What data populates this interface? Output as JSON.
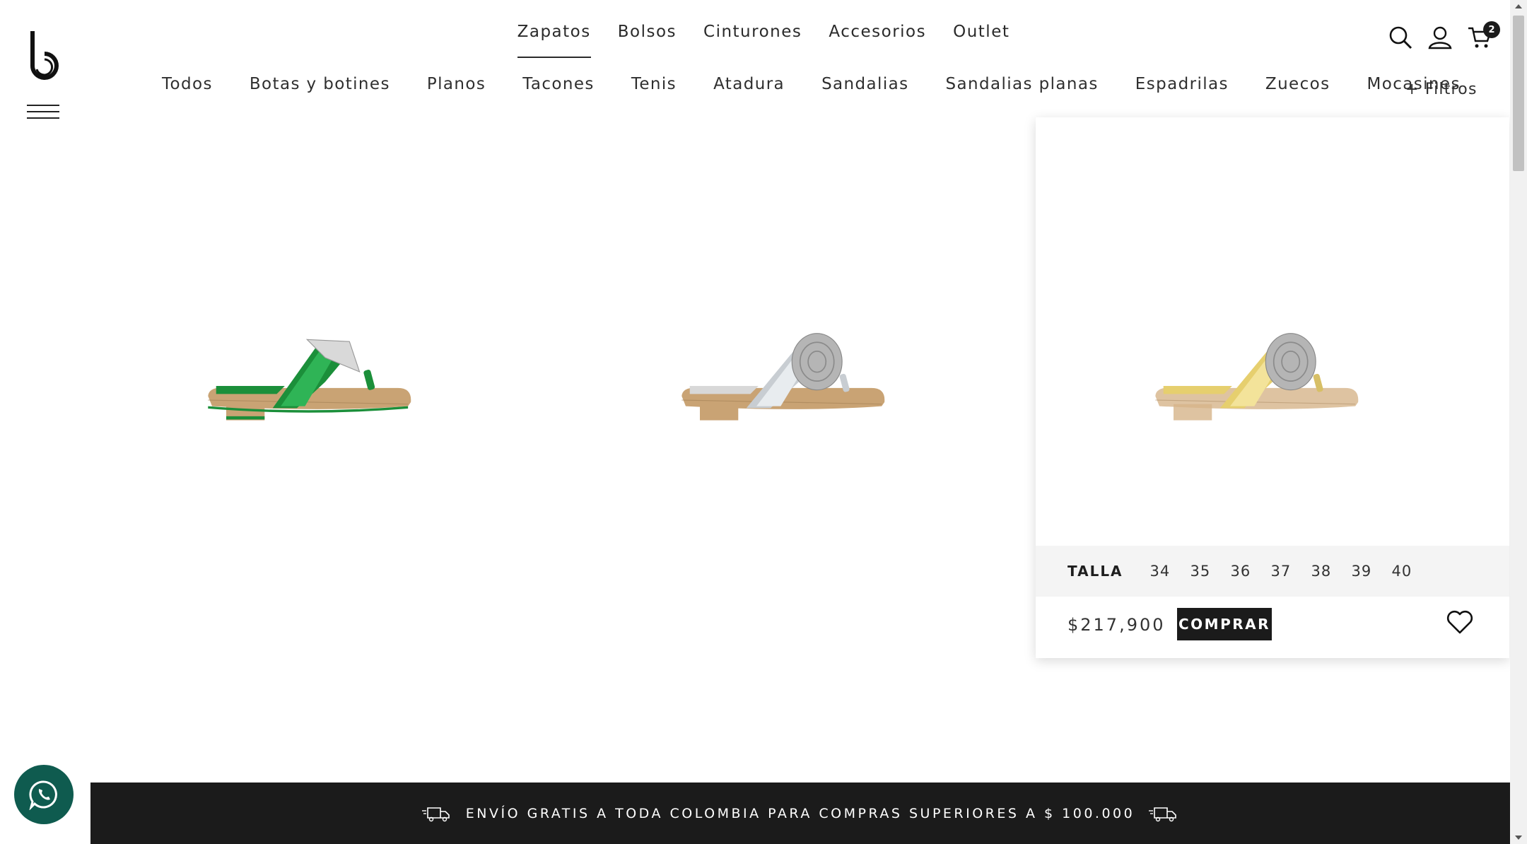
{
  "brand": {
    "logo_icon": "b-logo-icon"
  },
  "main_nav": [
    {
      "label": "Zapatos",
      "active": true
    },
    {
      "label": "Bolsos"
    },
    {
      "label": "Cinturones"
    },
    {
      "label": "Accesorios"
    },
    {
      "label": "Outlet"
    }
  ],
  "header_icons": {
    "search": "search-icon",
    "account": "user-icon",
    "cart": "cart-icon",
    "cart_count": "2"
  },
  "sub_nav": [
    "Todos",
    "Botas y botines",
    "Planos",
    "Tacones",
    "Tenis",
    "Atadura",
    "Sandalias",
    "Sandalias planas",
    "Espadrilas",
    "Zuecos",
    "Mocasines"
  ],
  "filters_label": "+ Filtros",
  "products": [
    {
      "color": "green",
      "accent": "#1b8f3a"
    },
    {
      "color": "silver",
      "accent": "#c8cdd2"
    },
    {
      "color": "gold",
      "accent": "#e6cf6e"
    }
  ],
  "hover_card": {
    "talla_label": "TALLA",
    "sizes": [
      "34",
      "35",
      "36",
      "37",
      "38",
      "39",
      "40"
    ],
    "price": "$217,900",
    "buy_label": "COMPRAR"
  },
  "banner": {
    "text": "ENVÍO GRATIS A TODA COLOMBIA PARA COMPRAS SUPERIORES A $ 100.000"
  },
  "colors": {
    "dark": "#1b1b1b",
    "whatsapp": "#0f5b4f"
  }
}
